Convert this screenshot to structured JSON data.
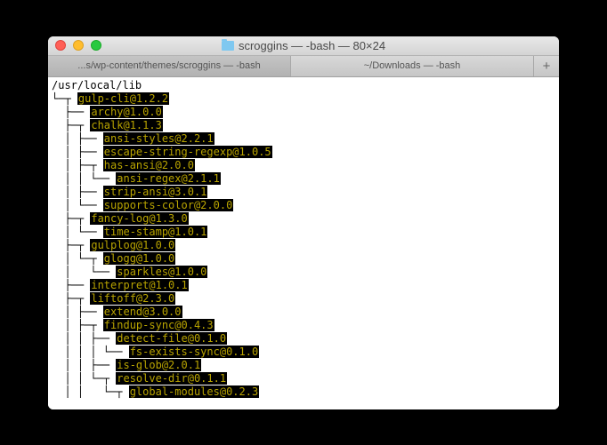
{
  "window": {
    "title": "scroggins — -bash — 80×24"
  },
  "tabs": [
    {
      "label": "...s/wp-content/themes/scroggins — -bash",
      "active": true
    },
    {
      "label": "~/Downloads — -bash",
      "active": false
    }
  ],
  "terminal": {
    "root": "/usr/local/lib",
    "lines": [
      {
        "prefix": "└─┬ ",
        "pkg": "gulp-cli@1.2.2"
      },
      {
        "prefix": "  ├── ",
        "pkg": "archy@1.0.0"
      },
      {
        "prefix": "  ├─┬ ",
        "pkg": "chalk@1.1.3"
      },
      {
        "prefix": "  │ ├── ",
        "pkg": "ansi-styles@2.2.1"
      },
      {
        "prefix": "  │ ├── ",
        "pkg": "escape-string-regexp@1.0.5"
      },
      {
        "prefix": "  │ ├─┬ ",
        "pkg": "has-ansi@2.0.0"
      },
      {
        "prefix": "  │ │ └── ",
        "pkg": "ansi-regex@2.1.1"
      },
      {
        "prefix": "  │ ├── ",
        "pkg": "strip-ansi@3.0.1"
      },
      {
        "prefix": "  │ └── ",
        "pkg": "supports-color@2.0.0"
      },
      {
        "prefix": "  ├─┬ ",
        "pkg": "fancy-log@1.3.0"
      },
      {
        "prefix": "  │ └── ",
        "pkg": "time-stamp@1.0.1"
      },
      {
        "prefix": "  ├─┬ ",
        "pkg": "gulplog@1.0.0"
      },
      {
        "prefix": "  │ └─┬ ",
        "pkg": "glogg@1.0.0"
      },
      {
        "prefix": "  │   └── ",
        "pkg": "sparkles@1.0.0"
      },
      {
        "prefix": "  ├── ",
        "pkg": "interpret@1.0.1"
      },
      {
        "prefix": "  ├─┬ ",
        "pkg": "liftoff@2.3.0"
      },
      {
        "prefix": "  │ ├── ",
        "pkg": "extend@3.0.0"
      },
      {
        "prefix": "  │ ├─┬ ",
        "pkg": "findup-sync@0.4.3"
      },
      {
        "prefix": "  │ │ ├── ",
        "pkg": "detect-file@0.1.0"
      },
      {
        "prefix": "  │ │ │ └── ",
        "pkg": "fs-exists-sync@0.1.0"
      },
      {
        "prefix": "  │ │ ├── ",
        "pkg": "is-glob@2.0.1"
      },
      {
        "prefix": "  │ │ └─┬ ",
        "pkg": "resolve-dir@0.1.1"
      },
      {
        "prefix": "  │ │   └─┬ ",
        "pkg": "global-modules@0.2.3"
      }
    ]
  }
}
